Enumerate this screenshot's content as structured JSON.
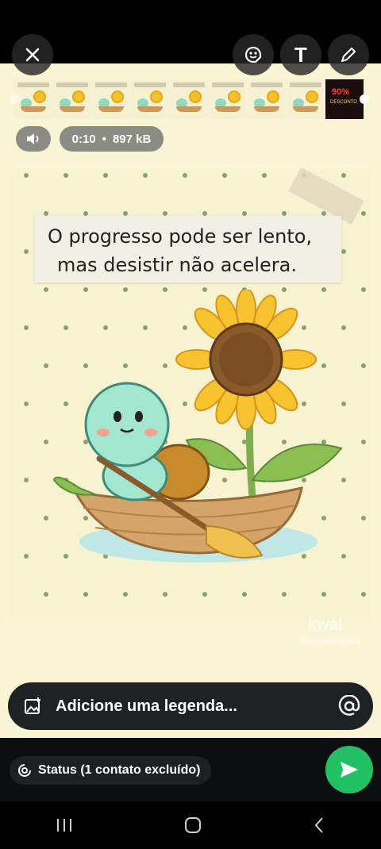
{
  "toolbar": {
    "close_icon": "close-icon",
    "sticker_icon": "sticker-icon",
    "text_icon": "text-icon",
    "text_glyph": "T",
    "pen_icon": "pen-icon"
  },
  "trimmer": {
    "thumbnail_count": 9,
    "last_thumb_text": "90%",
    "last_thumb_subtext": "DESCONTO"
  },
  "media_info": {
    "mute_icon": "speaker-icon",
    "duration": "0:10",
    "separator": "•",
    "size": "897 kB"
  },
  "artwork": {
    "quote_line1": "O progresso pode ser lento,",
    "quote_line2": "mas desistir não acelera.",
    "watermark": "kwai",
    "watermark_user": "@Pensadoraliud21"
  },
  "caption": {
    "placeholder": "Adicione uma legenda...",
    "image_icon": "add-image-icon",
    "mention_icon": "at-icon"
  },
  "footer": {
    "status_label": "Status (1 contato excluído)",
    "status_icon": "status-icon",
    "send_icon": "send-icon"
  },
  "colors": {
    "accent_send": "#21c063",
    "media_bg": "#f8f4d4"
  },
  "navbar": {
    "recent_icon": "recent-apps-icon",
    "home_icon": "home-icon",
    "back_icon": "back-icon"
  }
}
